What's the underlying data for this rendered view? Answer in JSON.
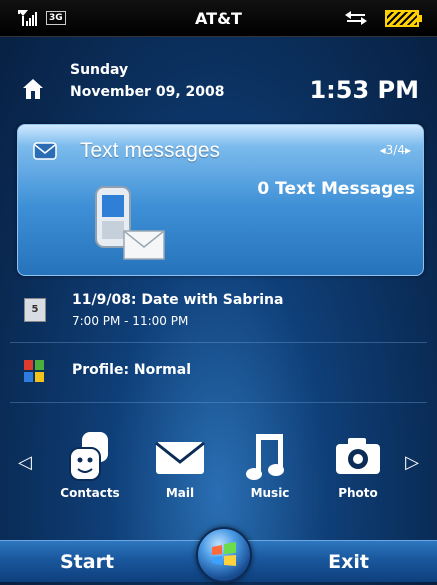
{
  "status_bar": {
    "carrier": "AT&T",
    "network_badge": "3G",
    "signal_icon": "signal-icon",
    "sync_icon": "data-sync-icon",
    "battery_icon": "battery-icon"
  },
  "date_row": {
    "day": "Sunday",
    "date": "November 09, 2008",
    "time": "1:53 PM"
  },
  "card": {
    "title": "Text messages",
    "pager": "◂3/4▸",
    "count": "0 Text Messages"
  },
  "appointment": {
    "title": "11/9/08: Date with Sabrina",
    "time": "7:00 PM - 11:00 PM",
    "icon_text": "5"
  },
  "profile": {
    "label": "Profile: Normal"
  },
  "launcher": {
    "apps": [
      {
        "label": "Contacts",
        "icon": "contacts-icon"
      },
      {
        "label": "Mail",
        "icon": "mail-icon"
      },
      {
        "label": "Music",
        "icon": "music-icon"
      },
      {
        "label": "Photo",
        "icon": "camera-icon"
      }
    ]
  },
  "softkeys": {
    "left": "Start",
    "right": "Exit"
  },
  "colors": {
    "accent": "#3d8fd6",
    "battery": "#ffd100",
    "background": "#0a2c57"
  }
}
